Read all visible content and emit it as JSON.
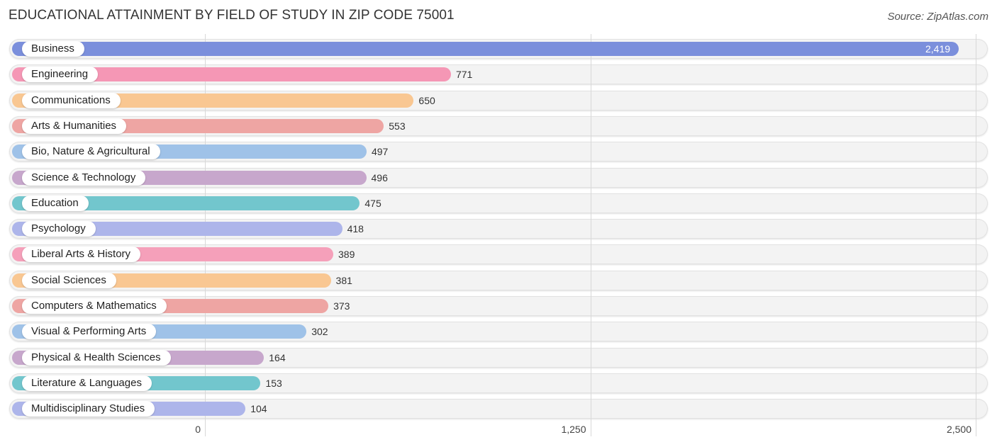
{
  "title": "EDUCATIONAL ATTAINMENT BY FIELD OF STUDY IN ZIP CODE 75001",
  "source": "Source: ZipAtlas.com",
  "chart_data": {
    "type": "bar",
    "orientation": "horizontal",
    "title": "EDUCATIONAL ATTAINMENT BY FIELD OF STUDY IN ZIP CODE 75001",
    "xlabel": "",
    "ylabel": "",
    "xlim": [
      0,
      2500
    ],
    "x_ticks": [
      "0",
      "1,250",
      "2,500"
    ],
    "x_tick_values": [
      0,
      1250,
      2500
    ],
    "grid": true,
    "categories": [
      "Business",
      "Engineering",
      "Communications",
      "Arts & Humanities",
      "Bio, Nature & Agricultural",
      "Science & Technology",
      "Education",
      "Psychology",
      "Liberal Arts & History",
      "Social Sciences",
      "Computers & Mathematics",
      "Visual & Performing Arts",
      "Physical & Health Sciences",
      "Literature & Languages",
      "Multidisciplinary Studies"
    ],
    "values": [
      2419,
      771,
      650,
      553,
      497,
      496,
      475,
      418,
      389,
      381,
      373,
      302,
      164,
      153,
      104
    ],
    "value_labels": [
      "2,419",
      "771",
      "650",
      "553",
      "497",
      "496",
      "475",
      "418",
      "389",
      "381",
      "373",
      "302",
      "164",
      "153",
      "104"
    ],
    "colors": [
      "#7b8fdc",
      "#f597b5",
      "#f9c792",
      "#eea5a3",
      "#9fc2e8",
      "#c7a7cc",
      "#72c6cd",
      "#adb5ea",
      "#f5a0ba",
      "#f9c792",
      "#eea5a3",
      "#9fc2e8",
      "#c7a7cc",
      "#72c6cd",
      "#adb5ea"
    ]
  }
}
